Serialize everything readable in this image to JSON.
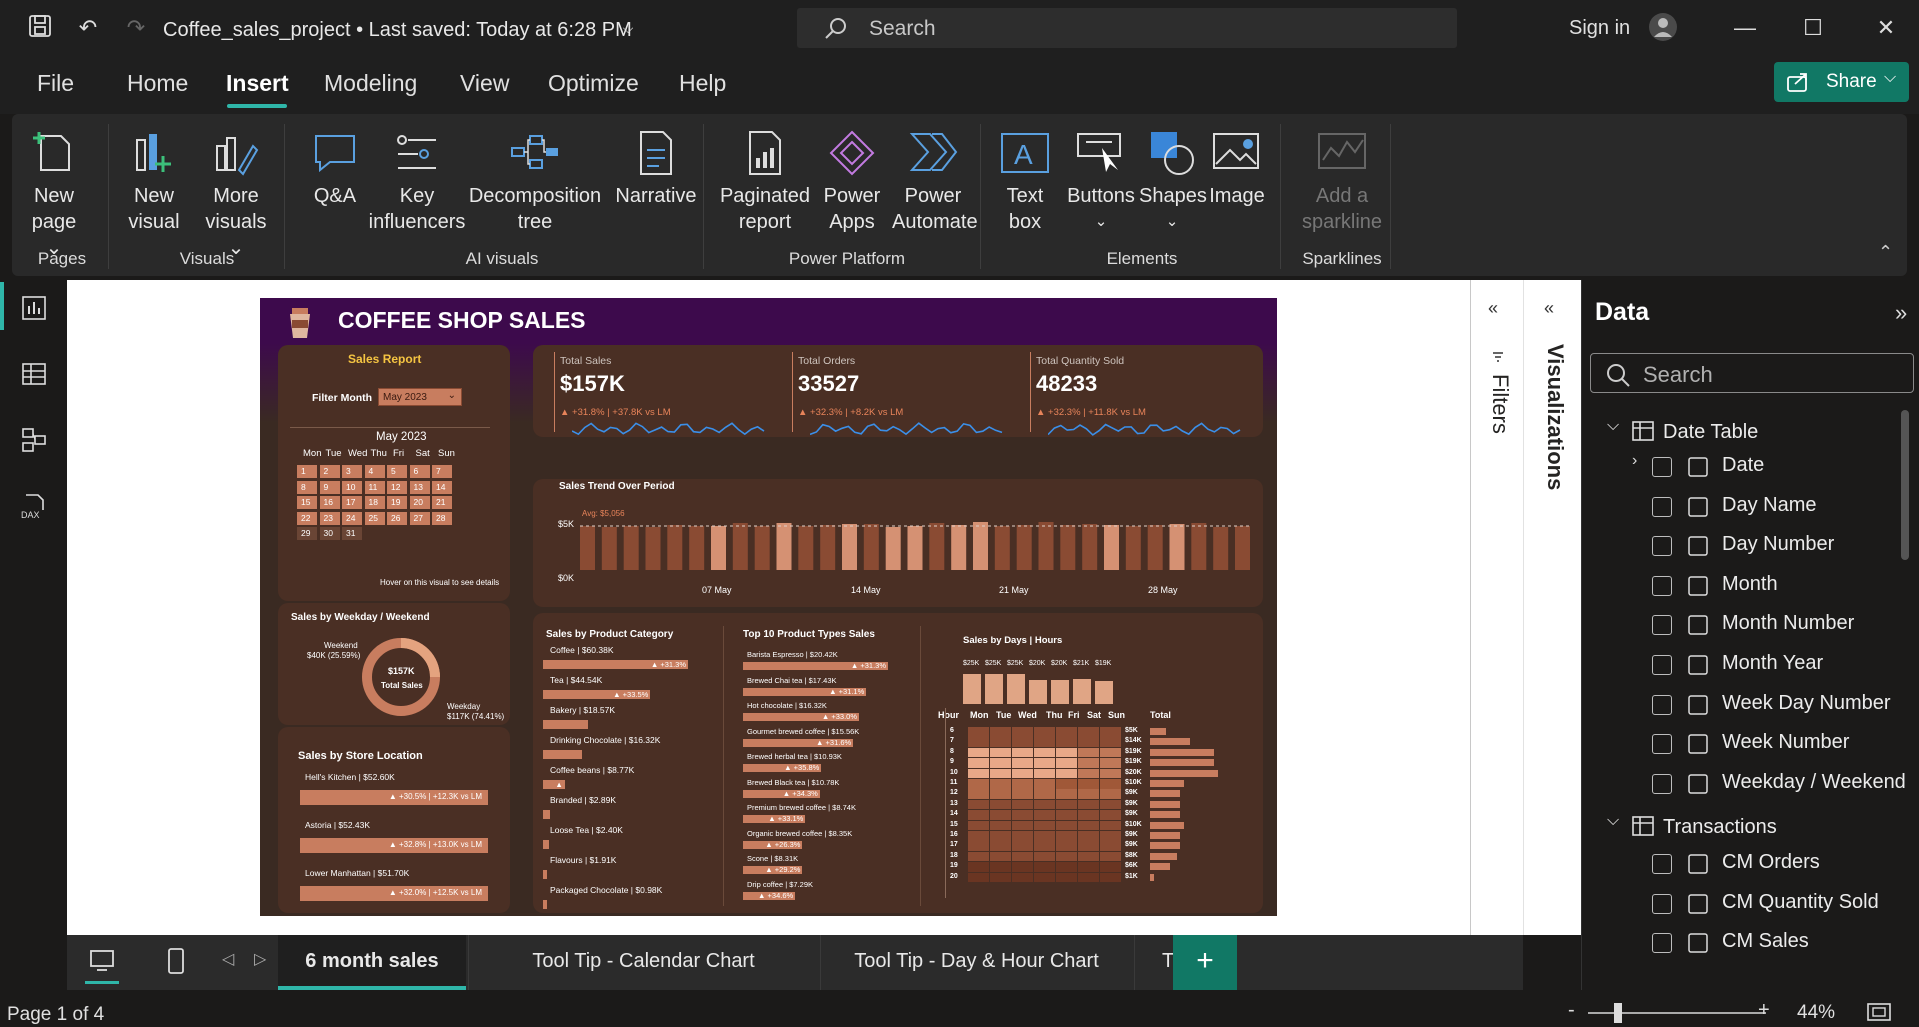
{
  "window": {
    "doc_title": "Coffee_sales_project • Last saved: Today at 6:28 PM",
    "search_placeholder": "Search",
    "sign_in": "Sign in"
  },
  "menu": {
    "items": [
      "File",
      "Home",
      "Insert",
      "Modeling",
      "View",
      "Optimize",
      "Help"
    ],
    "active": "Insert",
    "share_label": "Share"
  },
  "ribbon": {
    "new_page": [
      "New",
      "page"
    ],
    "new_visual": [
      "New",
      "visual"
    ],
    "more_visuals": [
      "More",
      "visuals"
    ],
    "qa": "Q&A",
    "key_influencers": [
      "Key",
      "influencers"
    ],
    "decomposition": [
      "Decomposition",
      "tree"
    ],
    "narrative": "Narrative",
    "paginated": [
      "Paginated",
      "report"
    ],
    "power_apps": [
      "Power",
      "Apps"
    ],
    "power_automate": [
      "Power",
      "Automate"
    ],
    "text_box": [
      "Text",
      "box"
    ],
    "buttons": "Buttons",
    "shapes": "Shapes",
    "image": "Image",
    "sparkline": [
      "Add a",
      "sparkline"
    ],
    "groups": {
      "pages": "Pages",
      "visuals": "Visuals",
      "ai": "AI visuals",
      "platform": "Power Platform",
      "elements": "Elements",
      "sparklines": "Sparklines"
    }
  },
  "report": {
    "title": "COFFEE SHOP SALES",
    "sales_report": "Sales Report",
    "filter_label": "Filter Month",
    "filter_value": "May 2023",
    "calendar_title": "May 2023",
    "weekdays": [
      "Mon",
      "Tue",
      "Wed",
      "Thu",
      "Fri",
      "Sat",
      "Sun"
    ],
    "calendar_days": [
      "1",
      "2",
      "3",
      "4",
      "5",
      "6",
      "7",
      "8",
      "9",
      "10",
      "11",
      "12",
      "13",
      "14",
      "15",
      "16",
      "17",
      "18",
      "19",
      "20",
      "21",
      "22",
      "23",
      "24",
      "25",
      "26",
      "27",
      "28",
      "29",
      "30",
      "31"
    ],
    "hover_hint": "Hover on this visual to see details",
    "kpis": [
      {
        "label": "Total Sales",
        "value": "$157K",
        "change": "▲ +31.8% | +37.8K vs LM"
      },
      {
        "label": "Total Orders",
        "value": "33527",
        "change": "▲ +32.3% | +8.2K vs LM"
      },
      {
        "label": "Total Quantity Sold",
        "value": "48233",
        "change": "▲ +32.3% | +11.8K vs LM"
      }
    ],
    "trend": {
      "title": "Sales Trend Over Period",
      "avg_label": "Avg: $5,056",
      "y_ticks": [
        "$5K",
        "$0K"
      ],
      "x_ticks": [
        "07 May",
        "14 May",
        "21 May",
        "28 May"
      ]
    },
    "weekday": {
      "title": "Sales by Weekday / Weekend",
      "center_value": "$157K",
      "center_label": "Total Sales",
      "weekend_label": "Weekend",
      "weekend_value": "$40K (25.59%)",
      "weekday_label": "Weekday",
      "weekday_value": "$117K (74.41%)"
    },
    "store": {
      "title": "Sales by Store Location",
      "rows": [
        {
          "name": "Hell's Kitchen | $52.60K",
          "change": "▲ +30.5% | +12.3K vs LM"
        },
        {
          "name": "Astoria | $52.43K",
          "change": "▲ +32.8% | +13.0K vs LM"
        },
        {
          "name": "Lower Manhattan | $51.70K",
          "change": "▲ +32.0% | +12.5K vs LM"
        }
      ]
    },
    "category": {
      "title": "Sales by Product Category",
      "rows": [
        {
          "name": "Coffee | $60.38K",
          "change": "▲ +31.3%",
          "pct": 100
        },
        {
          "name": "Tea | $44.54K",
          "change": "▲ +33.5%",
          "pct": 74
        },
        {
          "name": "Bakery | $18.57K",
          "change": "",
          "pct": 31
        },
        {
          "name": "Drinking Chocolate | $16.32K",
          "change": "",
          "pct": 27
        },
        {
          "name": "Coffee beans | $8.77K",
          "change": "▲",
          "pct": 15
        },
        {
          "name": "Branded | $2.89K",
          "change": "",
          "pct": 5
        },
        {
          "name": "Loose Tea | $2.40K",
          "change": "",
          "pct": 4
        },
        {
          "name": "Flavours | $1.91K",
          "change": "",
          "pct": 3
        },
        {
          "name": "Packaged Chocolate | $0.98K",
          "change": "",
          "pct": 2
        }
      ]
    },
    "top10": {
      "title": "Top 10 Product Types Sales",
      "rows": [
        {
          "name": "Barista Espresso | $20.42K",
          "change": "▲ +31.3%",
          "pct": 100
        },
        {
          "name": "Brewed Chai tea | $17.43K",
          "change": "▲ +31.1%",
          "pct": 85
        },
        {
          "name": "Hot chocolate | $16.32K",
          "change": "▲ +33.0%",
          "pct": 80
        },
        {
          "name": "Gourmet brewed coffee | $15.56K",
          "change": "▲ +31.6%",
          "pct": 76
        },
        {
          "name": "Brewed herbal tea | $10.93K",
          "change": "▲ +35.8%",
          "pct": 54
        },
        {
          "name": "Brewed Black tea | $10.78K",
          "change": "▲ +34.3%",
          "pct": 53
        },
        {
          "name": "Premium brewed coffee | $8.74K",
          "change": "▲ +33.1%",
          "pct": 43
        },
        {
          "name": "Organic brewed coffee | $8.35K",
          "change": "▲ +26.3%",
          "pct": 41
        },
        {
          "name": "Scone | $8.31K",
          "change": "▲ +29.2%",
          "pct": 41
        },
        {
          "name": "Drip coffee | $7.29K",
          "change": "▲ +34.6%",
          "pct": 36
        }
      ]
    },
    "heatmap": {
      "title": "Sales by Days | Hours",
      "day_totals": [
        "$25K",
        "$25K",
        "$25K",
        "$20K",
        "$20K",
        "$21K",
        "$19K"
      ],
      "day_headers": [
        "Hour",
        "Mon",
        "Tue",
        "Wed",
        "Thu",
        "Fri",
        "Sat",
        "Sun",
        "Total"
      ],
      "hours": [
        "6",
        "7",
        "8",
        "9",
        "10",
        "11",
        "12",
        "13",
        "14",
        "15",
        "16",
        "17",
        "18",
        "19",
        "20"
      ],
      "totals": [
        "$5K",
        "$14K",
        "$19K",
        "$19K",
        "$20K",
        "$10K",
        "$9K",
        "$9K",
        "$9K",
        "$10K",
        "$9K",
        "$9K",
        "$8K",
        "$6K",
        "$1K"
      ]
    }
  },
  "filters_label": "Filters",
  "viz_label": "Visualizations",
  "data_panel": {
    "title": "Data",
    "search_placeholder": "Search",
    "date_table": "Date Table",
    "date_fields": [
      "Date",
      "Day Name",
      "Day Number",
      "Month",
      "Month Number",
      "Month Year",
      "Week Day Number",
      "Week Number",
      "Weekday / Weekend"
    ],
    "transactions": "Transactions",
    "trans_fields": [
      "CM Orders",
      "CM Quantity Sold",
      "CM Sales"
    ]
  },
  "tabs": [
    "6 month sales",
    "Tool Tip - Calendar Chart",
    "Tool Tip - Day & Hour Chart",
    "TEST"
  ],
  "status": {
    "page": "Page 1 of 4",
    "zoom": "44%"
  },
  "colors": {
    "accent": "#2fb6a9",
    "share": "#117865",
    "report_bg": "#3a2a22",
    "header_purple": "#3d0a4c",
    "bar": "#c87d5f",
    "positive": "#e8845a"
  }
}
